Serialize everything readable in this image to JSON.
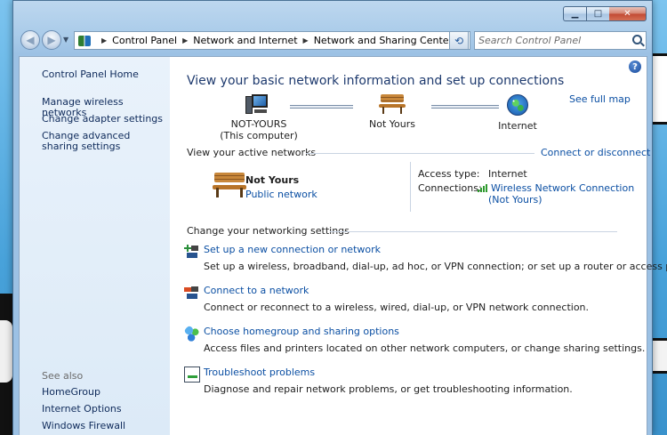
{
  "window": {
    "controls": {
      "minimize": "▁",
      "maximize": "□",
      "close": "✕"
    }
  },
  "address_bar": {
    "crumbs": [
      "Control Panel",
      "Network and Internet",
      "Network and Sharing Center"
    ],
    "search_placeholder": "Search Control Panel"
  },
  "left_pane": {
    "home": "Control Panel Home",
    "links": [
      "Manage wireless networks",
      "Change adapter settings",
      "Change advanced sharing settings"
    ],
    "see_also_label": "See also",
    "see_also": [
      "HomeGroup",
      "Internet Options",
      "Windows Firewall"
    ]
  },
  "main": {
    "help": "?",
    "title": "View your basic network information and set up connections",
    "see_full_map": "See full map",
    "map": {
      "computer_name": "NOT-YOURS",
      "computer_sub": "(This computer)",
      "network": "Not Yours",
      "internet": "Internet"
    },
    "active": {
      "header": "View your active networks",
      "connect_link": "Connect or disconnect",
      "network_name": "Not Yours",
      "network_category": "Public network",
      "access_type_label": "Access type:",
      "access_type_value": "Internet",
      "connections_label": "Connections:",
      "connection_name": "Wireless Network Connection",
      "connection_sub": "(Not Yours)"
    },
    "settings_header": "Change your networking settings",
    "tasks": [
      {
        "title": "Set up a new connection or network",
        "desc": "Set up a wireless, broadband, dial-up, ad hoc, or VPN connection; or set up a router or access point.",
        "icon": "network-setup-icon"
      },
      {
        "title": "Connect to a network",
        "desc": "Connect or reconnect to a wireless, wired, dial-up, or VPN network connection.",
        "icon": "connect-network-icon"
      },
      {
        "title": "Choose homegroup and sharing options",
        "desc": "Access files and printers located on other network computers, or change sharing settings.",
        "icon": "homegroup-icon"
      },
      {
        "title": "Troubleshoot problems",
        "desc": "Diagnose and repair network problems, or get troubleshooting information.",
        "icon": "troubleshoot-icon"
      }
    ]
  },
  "colors": {
    "link": "#0b4fa3",
    "title": "#1e3a6e",
    "left_pane": "#e9f2fb"
  }
}
